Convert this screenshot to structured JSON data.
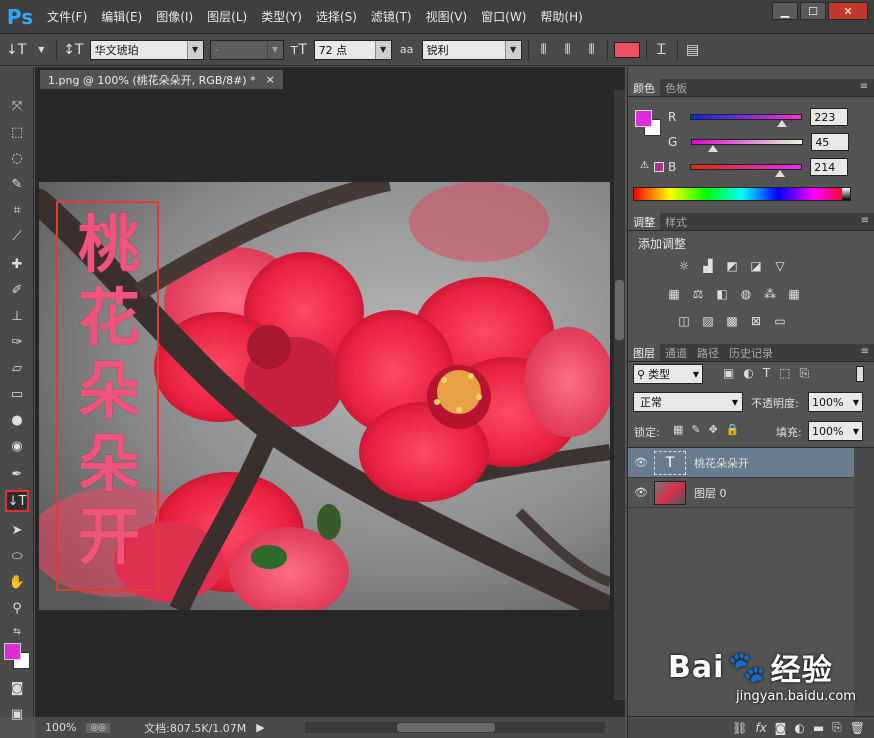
{
  "app": {
    "logo": "Ps"
  },
  "menu": [
    "文件(F)",
    "编辑(E)",
    "图像(I)",
    "图层(L)",
    "类型(Y)",
    "选择(S)",
    "滤镜(T)",
    "视图(V)",
    "窗口(W)",
    "帮助(H)"
  ],
  "options": {
    "font_family": "华文琥珀",
    "font_style": "-",
    "font_size": "72 点",
    "aa_label": "aa",
    "antialias": "锐利",
    "text_color": "#f05064"
  },
  "document": {
    "tab_title": "1.png @ 100% (桃花朵朵开, RGB/8#) *",
    "close": "×",
    "vertical_text": [
      "桃",
      "花",
      "朵",
      "朵",
      "开"
    ]
  },
  "status": {
    "zoom": "100%",
    "doc_info": "文档:807.5K/1.07M"
  },
  "color_panel": {
    "tabs": [
      "颜色",
      "色板"
    ],
    "r_label": "R",
    "r_value": "223",
    "g_label": "G",
    "g_value": "45",
    "b_label": "B",
    "b_value": "214",
    "foreground": "#df2dd6"
  },
  "adjust_panel": {
    "tabs": [
      "调整",
      "样式"
    ],
    "title": "添加调整"
  },
  "layers_panel": {
    "tabs": [
      "图层",
      "通道",
      "路径",
      "历史记录"
    ],
    "filter_kind": "类型",
    "blend_mode": "正常",
    "opacity_label": "不透明度:",
    "opacity": "100%",
    "lock_label": "锁定:",
    "fill_label": "填充:",
    "fill": "100%",
    "layers": [
      {
        "name": "桃花朵朵开",
        "type": "T"
      },
      {
        "name": "图层 0"
      }
    ]
  },
  "watermark": {
    "brand": "Bai",
    "brand_suffix": "经验",
    "url": "jingyan.baidu.com"
  }
}
